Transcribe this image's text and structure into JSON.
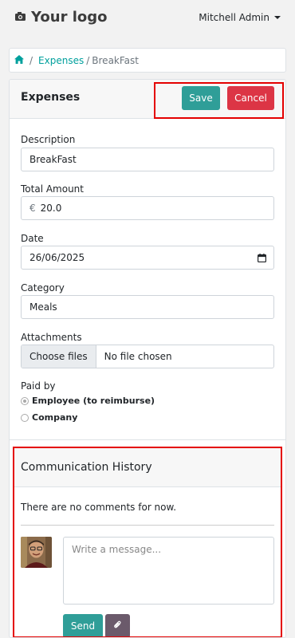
{
  "header": {
    "logo_text": "Your logo",
    "user_name": "Mitchell Admin"
  },
  "breadcrumb": {
    "home_icon": "home-icon",
    "separator": "/",
    "link": "Expenses",
    "current": "BreakFast"
  },
  "form": {
    "title": "Expenses",
    "save_label": "Save",
    "cancel_label": "Cancel",
    "description_label": "Description",
    "description_value": "BreakFast",
    "amount_label": "Total Amount",
    "currency_symbol": "€",
    "amount_value": "20.0",
    "date_label": "Date",
    "date_value": "26/06/2025",
    "category_label": "Category",
    "category_value": "Meals",
    "attachments_label": "Attachments",
    "choose_files_label": "Choose files",
    "file_status": "No file chosen",
    "paid_by_label": "Paid by",
    "paid_by_options": [
      "Employee (to reimburse)",
      "Company"
    ],
    "paid_by_selected": "Employee (to reimburse)"
  },
  "communication": {
    "title": "Communication History",
    "empty_text": "There are no comments for now.",
    "message_placeholder": "Write a message...",
    "send_label": "Send",
    "attach_icon": "paperclip-icon"
  },
  "colors": {
    "accent": "#00A09D",
    "save_button": "#2f9e98",
    "cancel_button": "#dc3545",
    "highlight": "#e40000"
  }
}
